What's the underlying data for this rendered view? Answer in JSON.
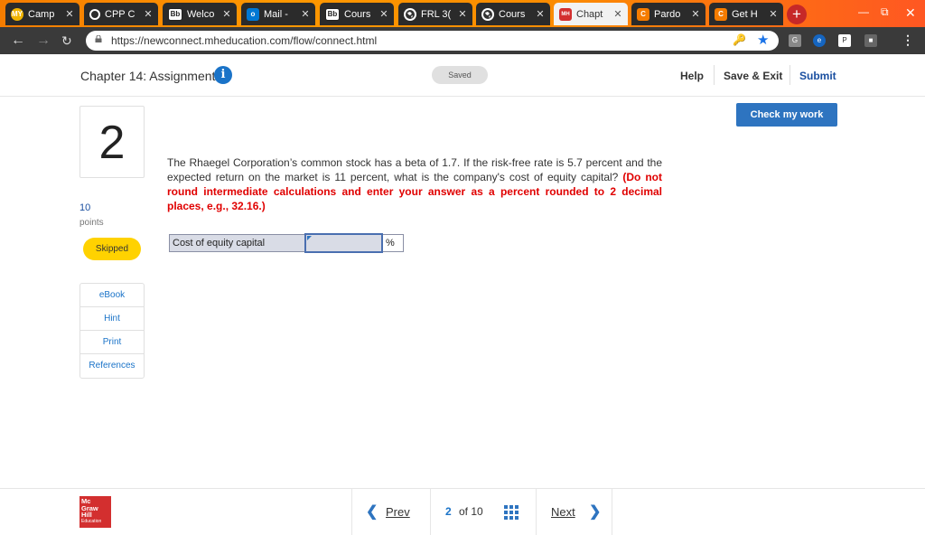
{
  "browser": {
    "tabs": [
      {
        "title": "Camp",
        "icon": "mycampus-icon",
        "color": "#f0b400"
      },
      {
        "title": "CPP C",
        "icon": "loading-circle-icon",
        "color": "#ffffff"
      },
      {
        "title": "Welco",
        "icon": "blackboard-icon",
        "color": "#ffffff"
      },
      {
        "title": "Mail -",
        "icon": "outlook-icon",
        "color": "#0078d4"
      },
      {
        "title": "Cours",
        "icon": "blackboard-icon",
        "color": "#ffffff"
      },
      {
        "title": "FRL 3(",
        "icon": "globe-icon",
        "color": "#ffffff"
      },
      {
        "title": "Cours",
        "icon": "globe-icon",
        "color": "#ffffff"
      },
      {
        "title": "Chapt",
        "icon": "mcgraw-hill-icon",
        "color": "#d32f2f"
      },
      {
        "title": "Pardo",
        "icon": "chegg-icon",
        "color": "#f57c00"
      },
      {
        "title": "Get H",
        "icon": "chegg-icon",
        "color": "#f57c00"
      }
    ],
    "favicon_text": {
      "camp": "MY",
      "bb": "Bb",
      "mail": "o",
      "mh": "MH",
      "chegg": "C"
    },
    "tab_close": "✕",
    "new_tab": "+",
    "url": "https://newconnect.mheducation.com/flow/connect.html"
  },
  "header": {
    "title": "Chapter 14: Assignment",
    "info_glyph": "i",
    "status": "Saved",
    "help": "Help",
    "save_exit": "Save & Exit",
    "submit": "Submit"
  },
  "question": {
    "number": "2",
    "points_value": "10",
    "points_label": "points",
    "status_badge": "Skipped",
    "check_button": "Check my work",
    "text": "The Rhaegel Corporation’s common stock has a beta of 1.7. If the risk-free rate is 5.7 percent and the expected return on the market is 11 percent, what is the company's cost of equity capital?",
    "instruction": "(Do not round intermediate calculations and enter your answer as a percent rounded to 2 decimal places, e.g., 32.16.)",
    "answer_label": "Cost of equity capital",
    "answer_value": "",
    "answer_unit": "%"
  },
  "resources": [
    "eBook",
    "Hint",
    "Print",
    "References"
  ],
  "footer": {
    "logo_lines": [
      "Mc",
      "Graw",
      "Hill",
      "Education"
    ],
    "prev": "Prev",
    "current_page": "2",
    "of_total": "of 10",
    "next": "Next"
  },
  "colors": {
    "accent": "#2e74c0",
    "skipped_badge": "#ffd200",
    "instruction_red": "#e00000"
  }
}
